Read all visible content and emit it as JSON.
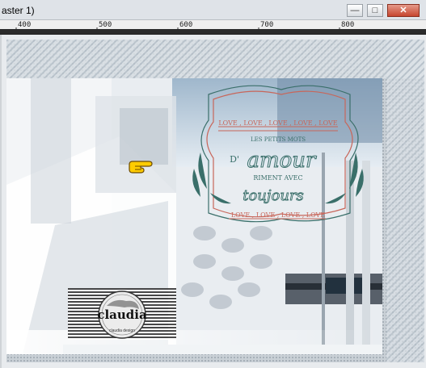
{
  "window": {
    "title": "aster 1)",
    "buttons": {
      "minimize": "—",
      "maximize": "□",
      "close": "✕"
    }
  },
  "ruler": {
    "labels": [
      "400",
      "500",
      "600",
      "700",
      "800"
    ]
  },
  "artwork": {
    "stamp": {
      "top_line": "LOVE , LOVE , LOVE , LOVE , LOVE",
      "small_line": "LES PETITS MOTS",
      "prefix": "D'",
      "main_word": "amour",
      "middle_line": "RIMENT AVEC",
      "script_word": "toujours",
      "bottom_line": "LOVE , LOVE , LOVE , LOVE"
    },
    "logo": {
      "name": "claudia",
      "subtitle": "claudia design"
    },
    "pointer_icon": "pointing-hand-icon",
    "colors": {
      "stamp_red": "#c8665a",
      "stamp_teal": "#3a6f6a",
      "accent_blue": "#5f86b5",
      "dark_bar": "#3e4752"
    }
  }
}
